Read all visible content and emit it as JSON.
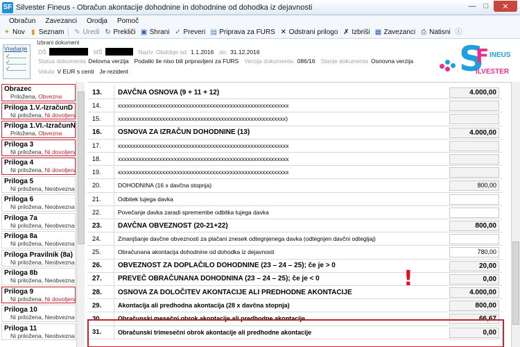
{
  "window": {
    "title": "Silvester Fineus - Obračun akontacije dohodnine in dohodnine od dohodka iz dejavnosti",
    "logo_letters": "SF"
  },
  "menu": [
    "Obračun",
    "Zavezanci",
    "Orodja",
    "Pomoč"
  ],
  "toolbar": [
    {
      "label": "Nov",
      "icon": "new-icon",
      "enabled": true
    },
    {
      "label": "Seznam",
      "icon": "folder-icon",
      "enabled": true
    },
    {
      "label": "Uredi",
      "icon": "edit-icon",
      "enabled": false
    },
    {
      "label": "Prekliči",
      "icon": "cancel-icon",
      "enabled": true
    },
    {
      "label": "Shrani",
      "icon": "save-icon",
      "enabled": true
    },
    {
      "label": "Preveri",
      "icon": "check-icon",
      "enabled": true
    },
    {
      "label": "Priprava za FURS",
      "icon": "prepare-icon",
      "enabled": true
    },
    {
      "label": "Odstrani prilogo",
      "icon": "remove-icon",
      "enabled": true
    },
    {
      "label": "Izbriši",
      "icon": "delete-icon",
      "enabled": true
    },
    {
      "label": "Zavezanci",
      "icon": "taxpayers-icon",
      "enabled": true
    },
    {
      "label": "Natisni",
      "icon": "print-icon",
      "enabled": true
    },
    {
      "label": "",
      "icon": "help-icon",
      "enabled": true
    }
  ],
  "doc": {
    "vnasanje": "Vnašanje",
    "izbrani_dokument": "Izbrani dokument",
    "ds_label": "DŠ",
    "ms_label": "MŠ",
    "naziv_label": "Naziv",
    "obdobje_od_label": "Obdobje od:",
    "obdobje_od": "1.1.2016",
    "do_label": "do:",
    "do": "31.12.2016",
    "status_label": "Status dokumenta",
    "status": "Delovna verzija",
    "podatki": "Podatki še niso bili pripravljeni za FURS",
    "verzija_label": "Verzija dokumenta:",
    "verzija": "086/16",
    "stanje_label": "Stanje dokumenta",
    "stanje": "Osnovna verzija",
    "valuta_label": "Valuta",
    "valuta": "V EUR s centi",
    "rezident": "Je rezident"
  },
  "logo": {
    "s": "S",
    "f": "F",
    "fineus": "INEUS",
    "ilvester": "ILVESTER"
  },
  "sidebar": [
    {
      "name": "Obrazec",
      "status1": "Priložena,",
      "status2": "Obvezna",
      "required": true
    },
    {
      "name": "Priloga 1.V.-IzračunD",
      "status1": "Ni priložena,",
      "status2": "Ni dovoljena",
      "required": true
    },
    {
      "name": "Priloga 1.VI.-IzračunN",
      "status1": "Priložena,",
      "status2": "Obvezna",
      "required": true
    },
    {
      "name": "Priloga 3",
      "status1": "Ni priložena,",
      "status2": "Ni dovoljena",
      "required": true
    },
    {
      "name": "Priloga 4",
      "status1": "Ni priložena,",
      "status2": "Ni dovoljena",
      "required": true
    },
    {
      "name": "Priloga 5",
      "status1": "Ni priložena,",
      "status2": "Neobvezna",
      "required": false
    },
    {
      "name": "Priloga 6",
      "status1": "Ni priložena,",
      "status2": "Neobvezna",
      "required": false
    },
    {
      "name": "Priloga 7a",
      "status1": "Ni priložena,",
      "status2": "Neobvezna",
      "required": false
    },
    {
      "name": "Priloga 8a",
      "status1": "Ni priložena,",
      "status2": "Neobvezna",
      "required": false
    },
    {
      "name": "Priloga Pravilnik (8a)",
      "status1": "Ni priložena,",
      "status2": "Neobvezna",
      "required": false
    },
    {
      "name": "Priloga 8b",
      "status1": "Ni priložena,",
      "status2": "Neobvezna",
      "required": false
    },
    {
      "name": "Priloga 9",
      "status1": "Ni priložena,",
      "status2": "Ni dovoljena",
      "required": true
    },
    {
      "name": "Priloga 10",
      "status1": "Ni priložena,",
      "status2": "Neobvezna",
      "required": false
    },
    {
      "name": "Priloga 11",
      "status1": "Ni priložena,",
      "status2": "Neobvezna",
      "required": false
    }
  ],
  "rows": [
    {
      "num": "13.",
      "label": "DAVČNA OSNOVA (9 + 11 + 12)",
      "value": "4.000,00",
      "bold": true,
      "field": "grey"
    },
    {
      "num": "14.",
      "label": "xxxxxxxxxxxxxxxxxxxxxxxxxxxxxxxxxxxxxxxxxxxxxxxxxxxxxxxxxx",
      "value": "",
      "bold": false,
      "field": "grey"
    },
    {
      "num": "15.",
      "label": "xxxxxxxxxxxxxxxxxxxxxxxxxxxxxxxxxxxxxxxxxxxxxxxxxxxxxxxxx)",
      "value": "",
      "bold": false,
      "field": "grey"
    },
    {
      "num": "16.",
      "label": "OSNOVA ZA IZRAČUN DOHODNINE (13)",
      "value": "4.000,00",
      "bold": true,
      "field": "grey"
    },
    {
      "num": "17.",
      "label": "xxxxxxxxxxxxxxxxxxxxxxxxxxxxxxxxxxxxxxxxxxxxxxxxxxxxxxxxxx",
      "value": "",
      "bold": false,
      "field": "grey"
    },
    {
      "num": "18.",
      "label": "xxxxxxxxxxxxxxxxxxxxxxxxxxxxxxxxxxxxxxxxxxxxxxxxxxxxxxxxxx",
      "value": "",
      "bold": false,
      "field": "grey"
    },
    {
      "num": "19.",
      "label": "xxxxxxxxxxxxxxxxxxxxxxxxxxxxxxxxxxxxxxxxxxxxxxxxxxxxxxxxxx",
      "value": "",
      "bold": false,
      "field": "grey"
    },
    {
      "num": "20.",
      "label": "DOHODNINA (16 x davčna stopnja)",
      "value": "800,00",
      "bold": false,
      "field": "grey"
    },
    {
      "num": "21.",
      "label": "Odbitek tujega davka",
      "value": "",
      "bold": false,
      "field": "white"
    },
    {
      "num": "22.",
      "label": "Povečanje davka zaradi spremembe odbitka tujega davka",
      "value": "",
      "bold": false,
      "field": "white"
    },
    {
      "num": "23.",
      "label": "DAVČNA OBVEZNOST (20-21+22)",
      "value": "800,00",
      "bold": true,
      "field": "grey"
    },
    {
      "num": "24.",
      "label": "Zmanjšanje davčne obveznosti za plačani znesek odtegnjenega davka (odtegnjen davčni odtegljaj)",
      "value": "",
      "bold": false,
      "field": "white"
    },
    {
      "num": "25.",
      "label": "Obračunana akontacija dohodnine od dohodka iz dejavnosti",
      "value": "780,00",
      "bold": false,
      "field": "white"
    },
    {
      "num": "26.",
      "label": "OBVEZNOST ZA DOPLAČILO DOHODNINE (23 – 24 – 25); če je > 0",
      "value": "20,00",
      "bold": true,
      "field": "grey"
    },
    {
      "num": "27.",
      "label": "PREVEČ OBRAČUNANA DOHODNINA (23 – 24 – 25); če je < 0",
      "value": "0,00",
      "bold": true,
      "field": "grey"
    },
    {
      "num": "28.",
      "label": "OSNOVA ZA DOLOČITEV AKONTACIJE ALI PREDHODNE AKONTACIJE",
      "value": "4.000,00",
      "bold": true,
      "field": "grey"
    },
    {
      "num": "29.",
      "label": "Akontacija ali predhodna akontacija (28 x davčna stopnja)",
      "value": "800,00",
      "bold": true,
      "field": "grey",
      "semibold": true
    },
    {
      "num": "30.",
      "label": "Obračunski mesečni obrok akontacije ali predhodne akontacije",
      "value": "66,67",
      "bold": true,
      "field": "grey",
      "semibold": true
    },
    {
      "num": "31.",
      "label": "Obračunski trimesečni obrok akontacije ali predhodne akontacije",
      "value": "0,00",
      "bold": true,
      "field": "grey",
      "semibold": true
    }
  ],
  "annotation": {
    "mark": "!"
  },
  "colors": {
    "accent_red": "#c8202e",
    "logo_blue": "#1fa0dc",
    "logo_pink": "#e8308c"
  }
}
